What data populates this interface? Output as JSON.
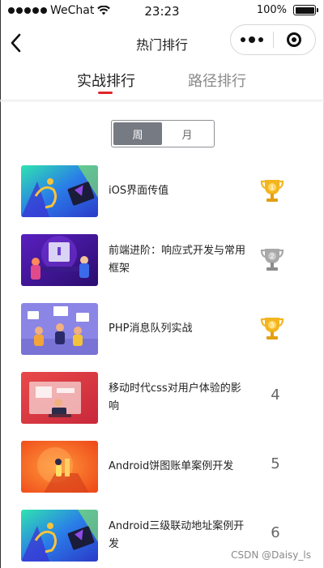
{
  "status_bar": {
    "carrier": "WeChat",
    "time": "23:23",
    "battery": "100%"
  },
  "nav": {
    "title": "热门排行",
    "back_icon": "chevron-left-icon",
    "more_icon": "more-dots-icon",
    "close_icon": "target-close-icon"
  },
  "tabs": [
    {
      "label": "实战排行",
      "active": true
    },
    {
      "label": "路径排行",
      "active": false
    }
  ],
  "period_toggle": {
    "options": [
      "周",
      "月"
    ],
    "selected": "周"
  },
  "courses": [
    {
      "title": "iOS界面传值",
      "rank": "1",
      "badge": "gold-trophy-icon"
    },
    {
      "title": "前端进阶：响应式开发与常用框架",
      "rank": "2",
      "badge": "silver-trophy-icon"
    },
    {
      "title": "PHP消息队列实战",
      "rank": "3",
      "badge": "bronze-trophy-icon"
    },
    {
      "title": "移动时代css对用户体验的影响",
      "rank": "4",
      "badge": null
    },
    {
      "title": "Android饼图账单案例开发",
      "rank": "5",
      "badge": null
    },
    {
      "title": "Android三级联动地址案例开发",
      "rank": "6",
      "badge": null
    }
  ],
  "watermark": "CSDN @Daisy_ls",
  "colors": {
    "accent": "#e0262a",
    "segment_active": "#767a82",
    "gold": "#f3b51f",
    "silver": "#a8a8a8"
  }
}
